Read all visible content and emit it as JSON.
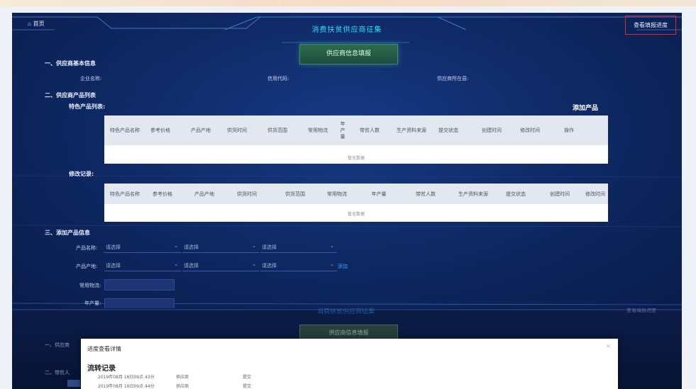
{
  "header": {
    "home_label": "首页",
    "title": "消费扶贫供应商征集",
    "progress_button": "查看填报进度",
    "fill_button": "供应商信息填报"
  },
  "section1": {
    "title": "一、供应商基本信息",
    "company_label": "企业名称:",
    "credit_label": "信用代码:",
    "location_label": "供应商所在县:"
  },
  "section2": {
    "title": "二、供应商产品列表",
    "list_label": "特色产品列表:",
    "add_button": "添加产品",
    "table1": {
      "columns": [
        "特色产品名称",
        "参考价格",
        "产品产地",
        "供货时间",
        "供货范围",
        "常用物流",
        "年产量",
        "带贫人数",
        "生产资料来源",
        "提交状态",
        "创建时间",
        "修改时间",
        "操作"
      ],
      "empty_text": "暂无数据"
    },
    "history_label": "修改记录:",
    "table2": {
      "columns": [
        "特色产品名称",
        "参考价格",
        "产品产地",
        "供货时间",
        "供货范围",
        "常用物流",
        "年产量",
        "带贫人数",
        "生产资料来源",
        "提交状态",
        "创建时间",
        "修改时间"
      ],
      "empty_text": "暂无数据"
    }
  },
  "section3": {
    "title": "三、添加产品信息",
    "name_label": "产品名称:",
    "origin_label": "产品产地:",
    "logistics_label": "常用物流:",
    "output_label": "年产量:",
    "select_placeholder": "请选择",
    "add_link": "添加"
  },
  "background_copy": {
    "title": "消费扶贫供应商征集",
    "progress_button": "查看填报进度",
    "fill_button": "供应商信息填报",
    "section1_title": "一、供应商",
    "section2_title": "二、带贫人"
  },
  "modal": {
    "title": "进度查看详情",
    "close_icon": "close-icon",
    "records_title": "流转记录",
    "records": [
      {
        "time": "2019年08月 16日09点 43分",
        "role": "供应商",
        "action": "提交"
      },
      {
        "time": "2019年08月 16日09点 44分",
        "role": "供应商",
        "action": "提交"
      }
    ]
  },
  "colors": {
    "accent_cyan": "#22e3ff",
    "panel_blue": "#0f2a66",
    "highlight_red": "#e2262b",
    "link_blue": "#409eff"
  }
}
